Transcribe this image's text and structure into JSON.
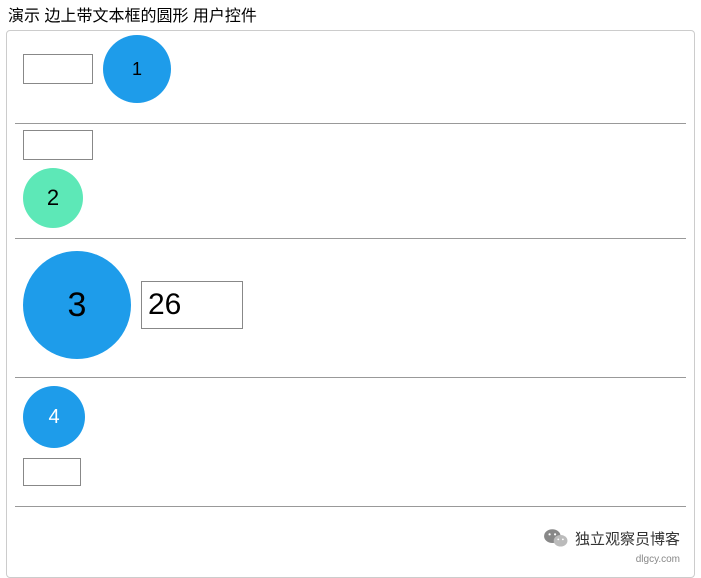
{
  "title": "演示 边上带文本框的圆形 用户控件",
  "rows": [
    {
      "textbox_value": "",
      "circle_label": "1",
      "circle_color": "#1e9cea"
    },
    {
      "textbox_value": "",
      "circle_label": "2",
      "circle_color": "#5de8b7"
    },
    {
      "textbox_value": "26",
      "circle_label": "3",
      "circle_color": "#1e9cea"
    },
    {
      "textbox_value": "",
      "circle_label": "4",
      "circle_color": "#1e9cea"
    }
  ],
  "watermark": {
    "text": "独立观察员博客",
    "sub": "dlgcy.com"
  }
}
